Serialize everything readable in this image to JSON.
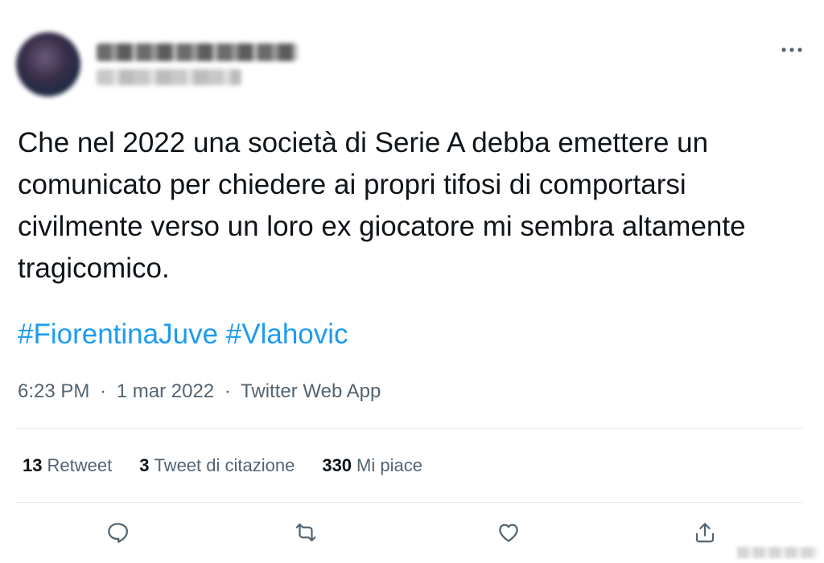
{
  "tweet": {
    "text": "Che nel 2022 una società di Serie A debba emettere un comunicato per chiedere ai propri tifosi di comportarsi civilmente verso un loro ex giocatore mi sembra altamente tragicomico.",
    "hashtags": [
      "#FiorentinaJuve",
      "#Vlahovic"
    ],
    "time": "6:23 PM",
    "date": "1 mar 2022",
    "source": "Twitter Web App",
    "separator": "·"
  },
  "stats": {
    "retweets_count": "13",
    "retweets_label": "Retweet",
    "quotes_count": "3",
    "quotes_label": "Tweet di citazione",
    "likes_count": "330",
    "likes_label": "Mi piace"
  },
  "icons": {
    "more": "more-horizontal-icon",
    "reply": "reply-icon",
    "retweet": "retweet-icon",
    "like": "heart-icon",
    "share": "share-icon"
  },
  "colors": {
    "accent": "#1d9bf0",
    "text": "#0f1419",
    "secondary": "#536471",
    "divider": "#e6ecf0"
  }
}
